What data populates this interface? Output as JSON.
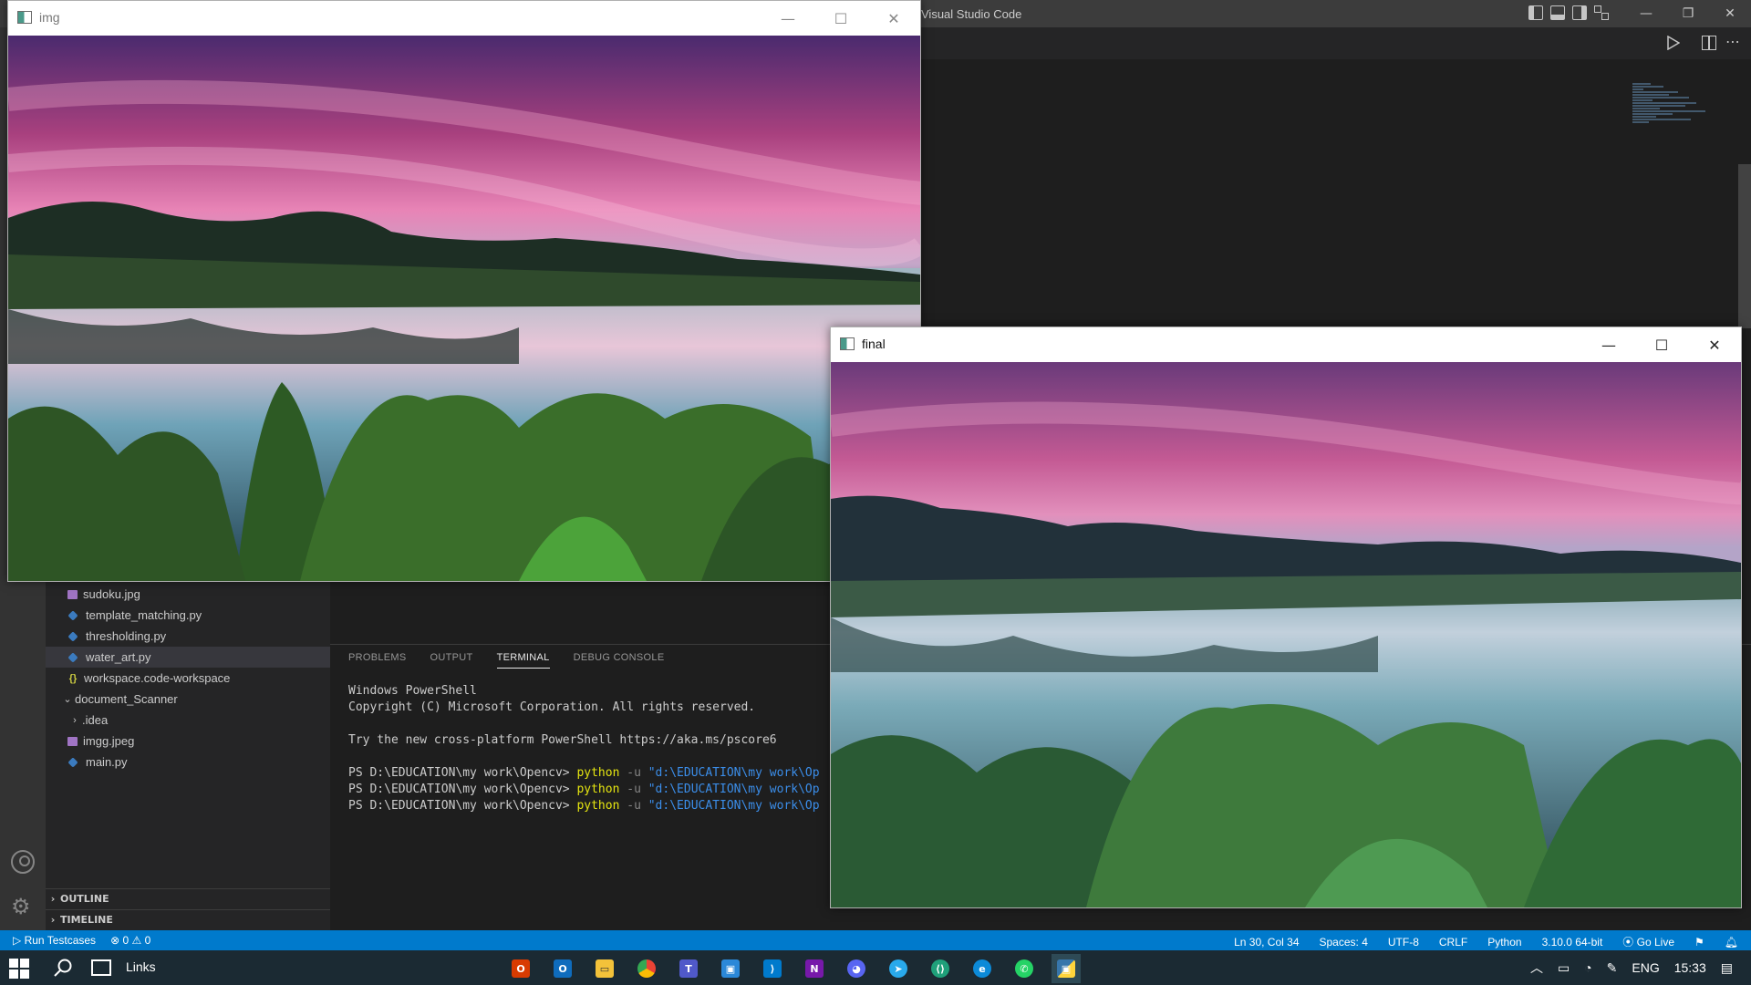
{
  "vscode": {
    "title": "Visual Studio Code",
    "tree": [
      {
        "label": "sudoku.jpg",
        "kind": "img"
      },
      {
        "label": "template_matching.py",
        "kind": "py"
      },
      {
        "label": "thresholding.py",
        "kind": "py"
      },
      {
        "label": "water_art.py",
        "kind": "py",
        "selected": true
      },
      {
        "label": "workspace.code-workspace",
        "kind": "json"
      },
      {
        "label": "document_Scanner",
        "kind": "folder-open"
      },
      {
        "label": ".idea",
        "kind": "folder-closed"
      },
      {
        "label": "imgg.jpeg",
        "kind": "img"
      },
      {
        "label": "main.py",
        "kind": "py"
      }
    ],
    "sections": {
      "outline": "OUTLINE",
      "timeline": "TIMELINE"
    },
    "panel_tabs": [
      "PROBLEMS",
      "OUTPUT",
      "TERMINAL",
      "DEBUG CONSOLE"
    ],
    "active_panel_tab": "TERMINAL",
    "terminal": {
      "line1": "Windows PowerShell",
      "line2": "Copyright (C) Microsoft Corporation. All rights reserved.",
      "line3": "Try the new cross-platform PowerShell https://aka.ms/pscore6",
      "prompt": "PS D:\\EDUCATION\\my work\\Opencv> ",
      "cmd": "python",
      "flag": " -u ",
      "path": "\"d:\\EDUCATION\\my work\\Op"
    },
    "status": {
      "run_testcases": "Run Testcases",
      "errors": "0",
      "warnings": "0",
      "position": "Ln 30, Col 34",
      "spaces": "Spaces: 4",
      "encoding": "UTF-8",
      "eol": "CRLF",
      "language": "Python",
      "interpreter": "3.10.0 64-bit",
      "golive": "Go Live"
    }
  },
  "windows": {
    "img": {
      "title": "img"
    },
    "final": {
      "title": "final"
    }
  },
  "window_controls": {
    "minimize": "—",
    "maximize": "☐",
    "close": "✕"
  },
  "taskbar": {
    "links": "Links",
    "apps": [
      "office-icon",
      "outlook-icon",
      "file-explorer-icon",
      "chrome-icon",
      "teams-icon",
      "store-icon",
      "vscode-icon",
      "onenote-icon",
      "discord-icon",
      "telegram-icon",
      "dev-icon",
      "edge-icon",
      "whatsapp-icon",
      "python-icon"
    ],
    "language": "ENG",
    "time": "15:33"
  },
  "colors": {
    "accent": "#007acc",
    "taskbar": "#1b2a33",
    "sidebar": "#252526",
    "editor": "#1e1e1e"
  }
}
